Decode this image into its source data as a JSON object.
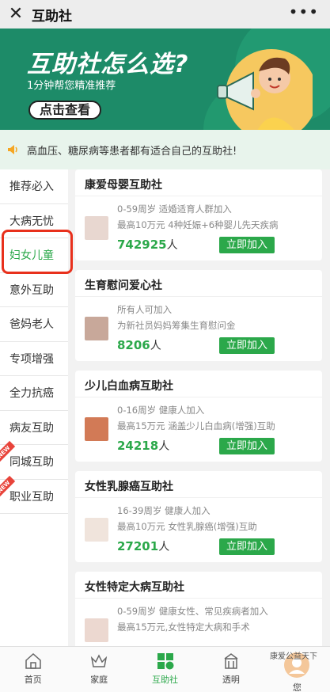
{
  "topbar": {
    "close_icon": "close-icon",
    "title": "互助社",
    "more_icon": "more-icon"
  },
  "banner": {
    "headline": "互助社怎么选?",
    "subtitle": "1分钟帮您精准推荐",
    "cta": "点击查看"
  },
  "notice": {
    "text": "高血压、糖尿病等患者都有适合自己的互助社!"
  },
  "sidebar": {
    "items": [
      {
        "label": "推荐必入",
        "new": false
      },
      {
        "label": "大病无忧",
        "new": false
      },
      {
        "label": "妇女儿童",
        "new": false
      },
      {
        "label": "意外互助",
        "new": false
      },
      {
        "label": "爸妈老人",
        "new": false
      },
      {
        "label": "专项增强",
        "new": false
      },
      {
        "label": "全力抗癌",
        "new": false
      },
      {
        "label": "病友互助",
        "new": false
      },
      {
        "label": "同城互助",
        "new": true
      },
      {
        "label": "职业互助",
        "new": true
      }
    ],
    "new_badge": "NEW"
  },
  "cards": [
    {
      "name": "康爱母婴互助社",
      "desc1": "0-59周岁 适婚适育人群加入",
      "desc2": "最高10万元 4种妊娠+6种婴儿先天疾病",
      "count": "742925",
      "unit": "人",
      "join": "立即加入",
      "thumb_color": "#e8d7d0"
    },
    {
      "name": "生育慰问爱心社",
      "desc1": "所有人可加入",
      "desc2": "为新社员妈妈筹集生育慰问金",
      "count": "8206",
      "unit": "人",
      "join": "立即加入",
      "thumb_color": "#c8a89a"
    },
    {
      "name": "少儿白血病互助社",
      "desc1": "0-16周岁 健康人加入",
      "desc2": "最高15万元 涵盖少儿白血病(增强)互助",
      "count": "24218",
      "unit": "人",
      "join": "立即加入",
      "thumb_color": "#d27a56"
    },
    {
      "name": "女性乳腺癌互助社",
      "desc1": "16-39周岁 健康人加入",
      "desc2": "最高10万元 女性乳腺癌(增强)互助",
      "count": "27201",
      "unit": "人",
      "join": "立即加入",
      "thumb_color": "#f0e4dc"
    },
    {
      "name": "女性特定大病互助社",
      "desc1": "0-59周岁 健康女性、常见疾病者加入",
      "desc2": "最高15万元,女性特定大病和手术",
      "count": "",
      "unit": "",
      "join": "",
      "thumb_color": "#ecd8d0"
    }
  ],
  "bottomnav": {
    "items": [
      {
        "label": "首页",
        "icon": "home-icon"
      },
      {
        "label": "家庭",
        "icon": "crown-icon"
      },
      {
        "label": "互助社",
        "icon": "grid-icon"
      },
      {
        "label": "透明",
        "icon": "building-icon"
      },
      {
        "label": "您",
        "icon": "user-icon"
      }
    ]
  },
  "watermark": "康爱公益天下",
  "colors": {
    "brand": "#2ba84a",
    "banner": "#1d8b68",
    "highlight": "#e8301c"
  }
}
